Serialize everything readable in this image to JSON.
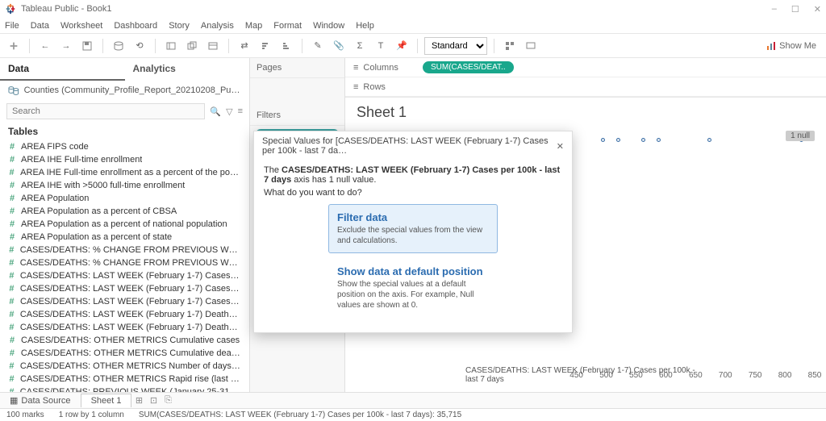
{
  "window": {
    "title": "Tableau Public - Book1",
    "min_icon": "–",
    "max_icon": "☐",
    "close_icon": "✕"
  },
  "menu": [
    "File",
    "Data",
    "Worksheet",
    "Dashboard",
    "Story",
    "Analysis",
    "Map",
    "Format",
    "Window",
    "Help"
  ],
  "toolbar": {
    "standard": "Standard",
    "show_me": "Show Me"
  },
  "side_tabs": {
    "data": "Data",
    "analytics": "Analytics"
  },
  "datasource": "Counties (Community_Profile_Report_20210208_Public)",
  "search_placeholder": "Search",
  "tables_header": "Tables",
  "fields": [
    "AREA FIPS code",
    "AREA IHE Full-time enrollment",
    "AREA IHE Full-time enrollment as a percent of the population",
    "AREA IHE with >5000 full-time enrollment",
    "AREA Population",
    "AREA Population as a percent of CBSA",
    "AREA Population as a percent of national population",
    "AREA Population as a percent of state",
    "CASES/DEATHS: % CHANGE FROM PREVIOUS WEEK Cas…",
    "CASES/DEATHS: % CHANGE FROM PREVIOUS WEEK Dea…",
    "CASES/DEATHS: LAST WEEK (February 1-7) Cases - last 7 …",
    "CASES/DEATHS: LAST WEEK (February 1-7) Cases as a pe…",
    "CASES/DEATHS: LAST WEEK (February 1-7) Cases per 10…",
    "CASES/DEATHS: LAST WEEK (February 1-7) Deaths - last 7…",
    "CASES/DEATHS: LAST WEEK (February 1-7) Deaths per 10…",
    "CASES/DEATHS: OTHER METRICS Cumulative cases",
    "CASES/DEATHS: OTHER METRICS Cumulative deaths",
    "CASES/DEATHS: OTHER METRICS Number of days of dow…",
    "CASES/DEATHS: OTHER METRICS Rapid rise (last 14 days)",
    "CASES/DEATHS: PREVIOUS WEEK (January 25-31) Cases …"
  ],
  "mid": {
    "pages": "Pages",
    "filters": "Filters",
    "filter_pill": "AREA State Abbrevia.."
  },
  "shelves": {
    "columns": "Columns",
    "rows": "Rows",
    "column_pill": "SUM(CASES/DEAT.."
  },
  "sheet_title": "Sheet 1",
  "axis": {
    "ticks": [
      "450",
      "500",
      "550",
      "600",
      "650",
      "700",
      "750",
      "800",
      "850"
    ],
    "title": "CASES/DEATHS: LAST WEEK (February 1-7) Cases per 100k - last 7 days"
  },
  "null_badge": "1 null",
  "dialog": {
    "title": "Special Values for [CASES/DEATHS: LAST WEEK (February 1-7) Cases per 100k - last 7 da…",
    "msg_pre": "The ",
    "msg_bold": "CASES/DEATHS: LAST WEEK (February 1-7) Cases per 100k - last 7 days",
    "msg_post": " axis has 1 null value.",
    "q": "What do you want to do?",
    "opt1_h": "Filter data",
    "opt1_p": "Exclude the special values from the view and calculations.",
    "opt2_h": "Show data at default position",
    "opt2_p": "Show the special values at a default position on the axis. For example, Null values are shown at 0."
  },
  "sheet_tabs": {
    "data_source": "Data Source",
    "sheet1": "Sheet 1"
  },
  "status": {
    "marks": "100 marks",
    "rows": "1 row by 1 column",
    "sum": "SUM(CASES/DEATHS: LAST WEEK (February 1-7) Cases per 100k - last 7 days): 35,715"
  },
  "chart_data": {
    "type": "scatter",
    "x_field": "CASES/DEATHS: LAST WEEK (February 1-7) Cases per 100k - last 7 days",
    "x_range": [
      0,
      900
    ],
    "approx_points": [
      5,
      10,
      15,
      20,
      25,
      30,
      35,
      38,
      42,
      48,
      55,
      60,
      65,
      75,
      80,
      88,
      100,
      105,
      108,
      110,
      113,
      118,
      120,
      125,
      128,
      132,
      138,
      145,
      150,
      152,
      155,
      158,
      162,
      168,
      172,
      175,
      178,
      185,
      195,
      200,
      205,
      215,
      225,
      232,
      240,
      258,
      265,
      300,
      310,
      330,
      345,
      350,
      380,
      395,
      410,
      480,
      510,
      560,
      590,
      690,
      870
    ],
    "null_count": 1
  }
}
